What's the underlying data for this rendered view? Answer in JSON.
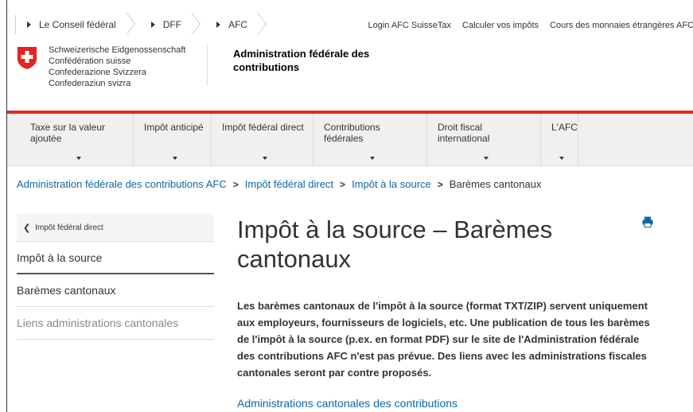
{
  "topbar": {
    "crumbs": [
      "Le Conseil fédéral",
      "DFF",
      "AFC"
    ],
    "links": [
      "Login AFC SuisseTax",
      "Calculer vos impôts",
      "Cours des monnaies étrangères AFC"
    ]
  },
  "header": {
    "confederation_lines": [
      "Schweizerische Eidgenossenschaft",
      "Confédération suisse",
      "Confederazione Svizzera",
      "Confederaziun svizra"
    ],
    "agency_name": "Administration fédérale des contributions"
  },
  "mainnav": {
    "items": [
      "Taxe sur la valeur ajoutée",
      "Impôt anticipé",
      "Impôt fédéral direct",
      "Contributions fédérales",
      "Droit fiscal international",
      "L'AFC"
    ]
  },
  "breadcrumb": {
    "items": [
      "Administration fédérale des contributions AFC",
      "Impôt fédéral direct",
      "Impôt à la source"
    ],
    "current": "Barèmes cantonaux"
  },
  "sidebar": {
    "back_label": "Impôt fédéral direct",
    "items": [
      "Impôt à la source",
      "Barèmes cantonaux",
      "Liens administrations cantonales"
    ]
  },
  "content": {
    "title": "Impôt à la source – Barèmes cantonaux",
    "intro": "Les barèmes cantonaux de l'impôt à la source (format TXT/ZIP) servent uniquement aux employeurs, fournisseurs de logiciels, etc. Une publication de tous les barèmes de l'impôt à la source (p.ex. en format PDF) sur le site de l'Administration fédérale des contributions AFC n'est pas prévue. Des liens avec les administrations fiscales cantonales seront par contre proposés.",
    "sub_link": "Administrations cantonales des contributions"
  },
  "colors": {
    "accent_red": "#e52322",
    "link_blue": "#0d66a6"
  },
  "icons": {
    "shield": "swiss-cross-icon",
    "print": "print-icon",
    "back": "chevron-left-icon"
  }
}
